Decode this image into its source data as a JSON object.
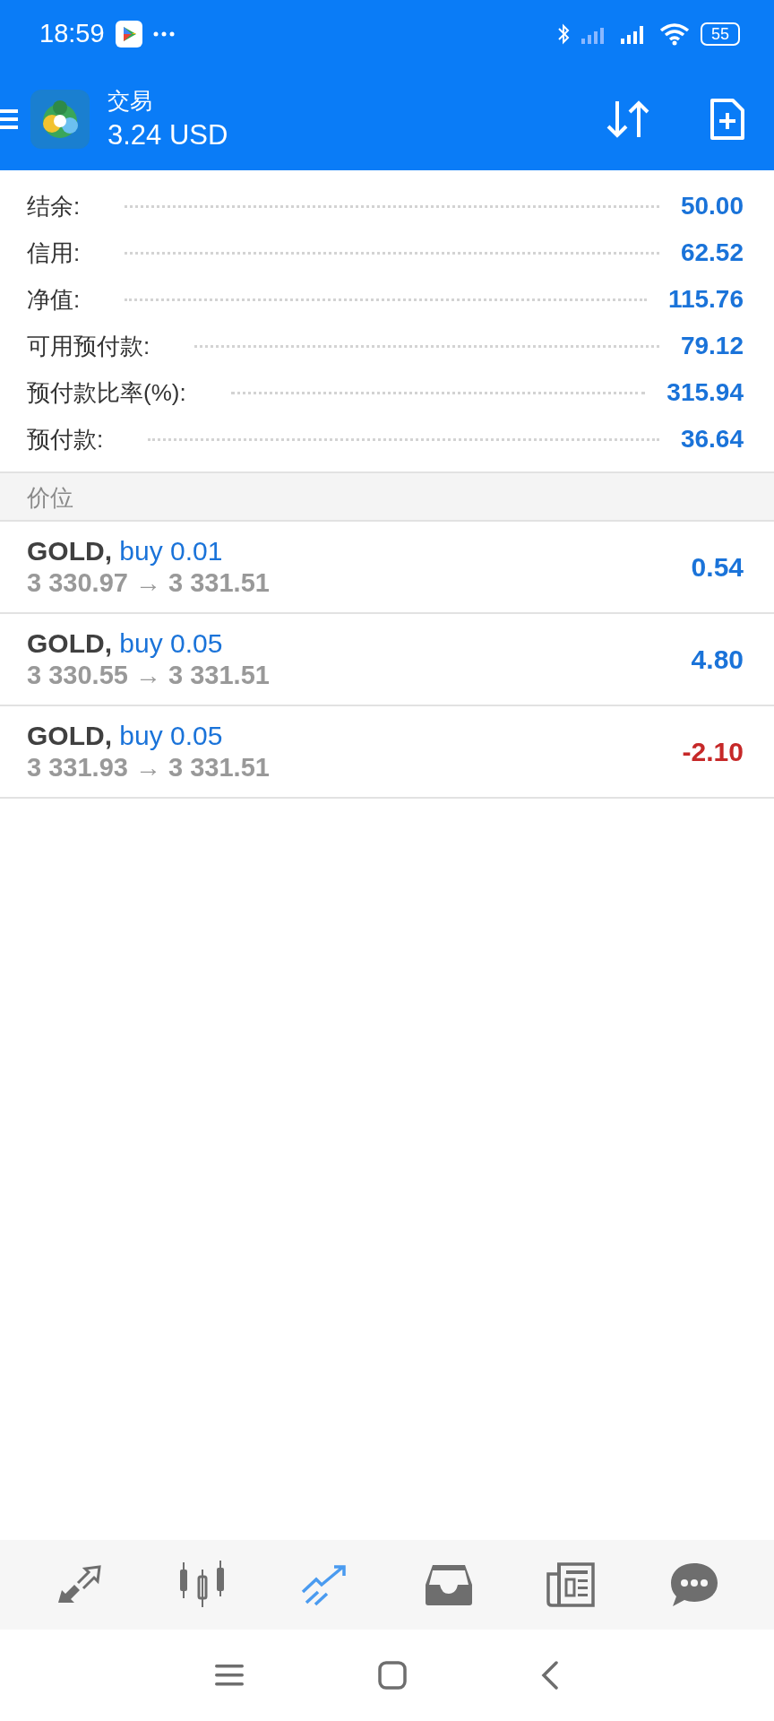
{
  "status_bar": {
    "time": "18:59",
    "battery": "55"
  },
  "header": {
    "title": "交易",
    "balance": "3.24 USD"
  },
  "summary": [
    {
      "label": "结余:",
      "value": "50.00"
    },
    {
      "label": "信用:",
      "value": "62.52"
    },
    {
      "label": "净值:",
      "value": "115.76"
    },
    {
      "label": "可用预付款:",
      "value": "79.12"
    },
    {
      "label": "预付款比率(%):",
      "value": "315.94"
    },
    {
      "label": "预付款:",
      "value": "36.64"
    }
  ],
  "section": {
    "title": "价位"
  },
  "positions": [
    {
      "symbol": "GOLD,",
      "side": "buy 0.01",
      "prices": "3 330.97 → 3 331.51",
      "profit": "0.54",
      "color": "#1a73d9"
    },
    {
      "symbol": "GOLD,",
      "side": "buy 0.05",
      "prices": "3 330.55 → 3 331.51",
      "profit": "4.80",
      "color": "#1a73d9"
    },
    {
      "symbol": "GOLD,",
      "side": "buy 0.05",
      "prices": "3 331.93 → 3 331.51",
      "profit": "-2.10",
      "color": "#c62828"
    }
  ],
  "bottom_nav": [
    {
      "kind": "quotes",
      "selected": false
    },
    {
      "kind": "chart",
      "selected": false
    },
    {
      "kind": "trade",
      "selected": true
    },
    {
      "kind": "history",
      "selected": false
    },
    {
      "kind": "news",
      "selected": false
    },
    {
      "kind": "chat",
      "selected": false
    }
  ]
}
